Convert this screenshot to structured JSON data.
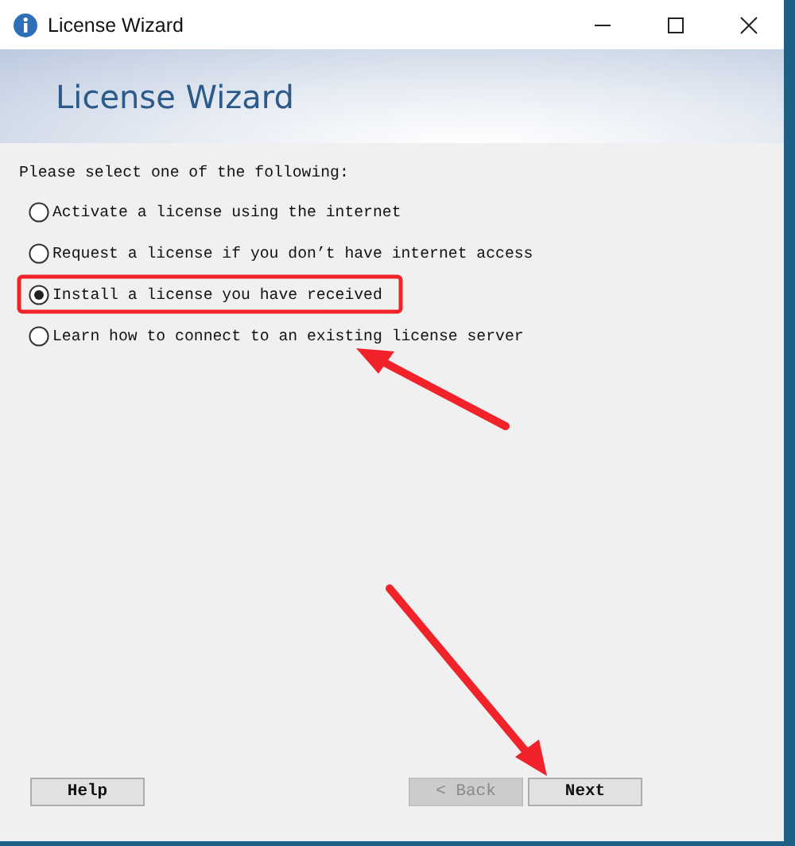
{
  "window": {
    "title": "License Wizard"
  },
  "header": {
    "title": "License Wizard"
  },
  "prompt": "Please select one of the following:",
  "options": [
    {
      "label": "Activate a license using the internet",
      "selected": false
    },
    {
      "label": "Request a license if you don’t have internet access",
      "selected": false
    },
    {
      "label": "Install a license you have received",
      "selected": true
    },
    {
      "label": "Learn how to connect to an existing license server",
      "selected": false
    }
  ],
  "buttons": [
    {
      "label": "Help",
      "disabled": false
    },
    {
      "label": "< Back",
      "disabled": true
    },
    {
      "label": "Next",
      "disabled": false
    }
  ]
}
